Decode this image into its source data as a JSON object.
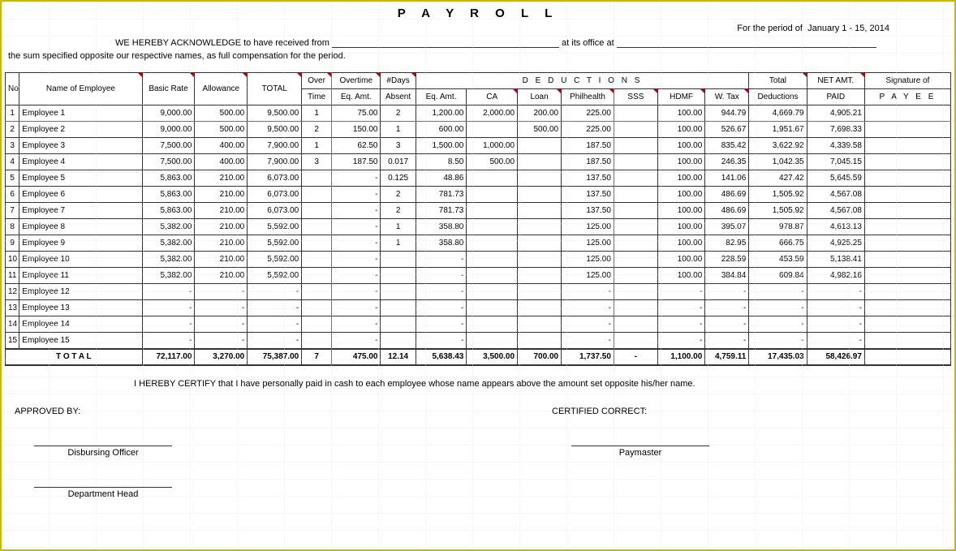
{
  "title": "P A Y R O L L",
  "period_prefix": "For the period of",
  "period_value": "January 1 - 15,  2014",
  "ack1_pre": "WE HEREBY ACKNOWLEDGE to have received from",
  "ack1_mid": "at its office at",
  "ack2": "the sum specified opposite our respective names, as full compensation for the period.",
  "headers": {
    "no": "No.",
    "name": "Name of Employee",
    "basic": "Basic Rate",
    "allow": "Allowance",
    "total": "TOTAL",
    "over": "Over",
    "time": "Time",
    "overtime": "Overtime",
    "eqamt": "Eq. Amt.",
    "days": "#Days",
    "absent": "Absent",
    "deductions": "D  E  D  U  C  T  I  O  N  S",
    "ca": "CA",
    "loan": "Loan",
    "phil": "Philhealth",
    "sss": "SSS",
    "hdmf": "HDMF",
    "wtax": "W. Tax",
    "totded": "Total",
    "totded2": "Deductions",
    "net": "NET AMT.",
    "paid": "PAID",
    "sig": "Signature of",
    "payee": "P A Y E E"
  },
  "rows": [
    {
      "no": "1",
      "name": "Employee 1",
      "basic": "9,000.00",
      "allow": "500.00",
      "total": "9,500.00",
      "ot": "1",
      "oteq": "75.00",
      "abs": "2",
      "abseq": "1,200.00",
      "ca": "2,000.00",
      "loan": "200.00",
      "phil": "225.00",
      "sss": "",
      "hdmf": "100.00",
      "wtax": "944.79",
      "ded": "4,669.79",
      "net": "4,905.21"
    },
    {
      "no": "2",
      "name": "Employee 2",
      "basic": "9,000.00",
      "allow": "500.00",
      "total": "9,500.00",
      "ot": "2",
      "oteq": "150.00",
      "abs": "1",
      "abseq": "600.00",
      "ca": "",
      "loan": "500.00",
      "phil": "225.00",
      "sss": "",
      "hdmf": "100.00",
      "wtax": "526.67",
      "ded": "1,951.67",
      "net": "7,698.33"
    },
    {
      "no": "3",
      "name": "Employee 3",
      "basic": "7,500.00",
      "allow": "400.00",
      "total": "7,900.00",
      "ot": "1",
      "oteq": "62.50",
      "abs": "3",
      "abseq": "1,500.00",
      "ca": "1,000.00",
      "loan": "",
      "phil": "187.50",
      "sss": "",
      "hdmf": "100.00",
      "wtax": "835.42",
      "ded": "3,622.92",
      "net": "4,339.58"
    },
    {
      "no": "4",
      "name": "Employee 4",
      "basic": "7,500.00",
      "allow": "400.00",
      "total": "7,900.00",
      "ot": "3",
      "oteq": "187.50",
      "abs": "0.017",
      "abseq": "8.50",
      "ca": "500.00",
      "loan": "",
      "phil": "187.50",
      "sss": "",
      "hdmf": "100.00",
      "wtax": "246.35",
      "ded": "1,042.35",
      "net": "7,045.15"
    },
    {
      "no": "5",
      "name": "Employee 5",
      "basic": "5,863.00",
      "allow": "210.00",
      "total": "6,073.00",
      "ot": "",
      "oteq": "-",
      "abs": "0.125",
      "abseq": "48.86",
      "ca": "",
      "loan": "",
      "phil": "137.50",
      "sss": "",
      "hdmf": "100.00",
      "wtax": "141.06",
      "ded": "427.42",
      "net": "5,645.59"
    },
    {
      "no": "6",
      "name": "Employee 6",
      "basic": "5,863.00",
      "allow": "210.00",
      "total": "6,073.00",
      "ot": "",
      "oteq": "-",
      "abs": "2",
      "abseq": "781.73",
      "ca": "",
      "loan": "",
      "phil": "137.50",
      "sss": "",
      "hdmf": "100.00",
      "wtax": "486.69",
      "ded": "1,505.92",
      "net": "4,567.08"
    },
    {
      "no": "7",
      "name": "Employee 7",
      "basic": "5,863.00",
      "allow": "210.00",
      "total": "6,073.00",
      "ot": "",
      "oteq": "-",
      "abs": "2",
      "abseq": "781.73",
      "ca": "",
      "loan": "",
      "phil": "137.50",
      "sss": "",
      "hdmf": "100.00",
      "wtax": "486.69",
      "ded": "1,505.92",
      "net": "4,567.08"
    },
    {
      "no": "8",
      "name": "Employee 8",
      "basic": "5,382.00",
      "allow": "210.00",
      "total": "5,592.00",
      "ot": "",
      "oteq": "-",
      "abs": "1",
      "abseq": "358.80",
      "ca": "",
      "loan": "",
      "phil": "125.00",
      "sss": "",
      "hdmf": "100.00",
      "wtax": "395.07",
      "ded": "978.87",
      "net": "4,613.13"
    },
    {
      "no": "9",
      "name": "Employee 9",
      "basic": "5,382.00",
      "allow": "210.00",
      "total": "5,592.00",
      "ot": "",
      "oteq": "-",
      "abs": "1",
      "abseq": "358.80",
      "ca": "",
      "loan": "",
      "phil": "125.00",
      "sss": "",
      "hdmf": "100.00",
      "wtax": "82.95",
      "ded": "666.75",
      "net": "4,925.25"
    },
    {
      "no": "10",
      "name": "Employee 10",
      "basic": "5,382.00",
      "allow": "210.00",
      "total": "5,592.00",
      "ot": "",
      "oteq": "-",
      "abs": "",
      "abseq": "-",
      "ca": "",
      "loan": "",
      "phil": "125.00",
      "sss": "",
      "hdmf": "100.00",
      "wtax": "228.59",
      "ded": "453.59",
      "net": "5,138.41"
    },
    {
      "no": "11",
      "name": "Employee 11",
      "basic": "5,382.00",
      "allow": "210.00",
      "total": "5,592.00",
      "ot": "",
      "oteq": "-",
      "abs": "",
      "abseq": "-",
      "ca": "",
      "loan": "",
      "phil": "125.00",
      "sss": "",
      "hdmf": "100.00",
      "wtax": "384.84",
      "ded": "609.84",
      "net": "4,982.16"
    },
    {
      "no": "12",
      "name": "Employee 12",
      "basic": "-",
      "allow": "-",
      "total": "-",
      "ot": "",
      "oteq": "-",
      "abs": "",
      "abseq": "-",
      "ca": "",
      "loan": "",
      "phil": "-",
      "sss": "",
      "hdmf": "-",
      "wtax": "-",
      "ded": "-",
      "net": "-"
    },
    {
      "no": "13",
      "name": "Employee 13",
      "basic": "-",
      "allow": "-",
      "total": "-",
      "ot": "",
      "oteq": "-",
      "abs": "",
      "abseq": "-",
      "ca": "",
      "loan": "",
      "phil": "-",
      "sss": "",
      "hdmf": "-",
      "wtax": "-",
      "ded": "-",
      "net": "-"
    },
    {
      "no": "14",
      "name": "Employee 14",
      "basic": "-",
      "allow": "-",
      "total": "-",
      "ot": "",
      "oteq": "-",
      "abs": "",
      "abseq": "-",
      "ca": "",
      "loan": "",
      "phil": "-",
      "sss": "",
      "hdmf": "-",
      "wtax": "-",
      "ded": "-",
      "net": "-"
    },
    {
      "no": "15",
      "name": "Employee 15",
      "basic": "-",
      "allow": "-",
      "total": "-",
      "ot": "",
      "oteq": "-",
      "abs": "",
      "abseq": "-",
      "ca": "",
      "loan": "",
      "phil": "-",
      "sss": "",
      "hdmf": "-",
      "wtax": "-",
      "ded": "-",
      "net": "-"
    }
  ],
  "total_row": {
    "label": "T O T A L",
    "basic": "72,117.00",
    "allow": "3,270.00",
    "total": "75,387.00",
    "ot": "7",
    "oteq": "475.00",
    "abs": "12.14",
    "abseq": "5,638.43",
    "ca": "3,500.00",
    "loan": "700.00",
    "phil": "1,737.50",
    "sss": "-",
    "hdmf": "1,100.00",
    "wtax": "4,759.11",
    "ded": "17,435.03",
    "net": "58,426.97"
  },
  "cert": "I HEREBY CERTIFY  that I have personally paid in cash to each employee whose name appears above the amount set opposite his/her name.",
  "approved": "APPROVED BY:",
  "certified": "CERTIFIED CORRECT:",
  "sig1": "Disbursing Officer",
  "sig2": "Paymaster",
  "sig3": "Department Head"
}
